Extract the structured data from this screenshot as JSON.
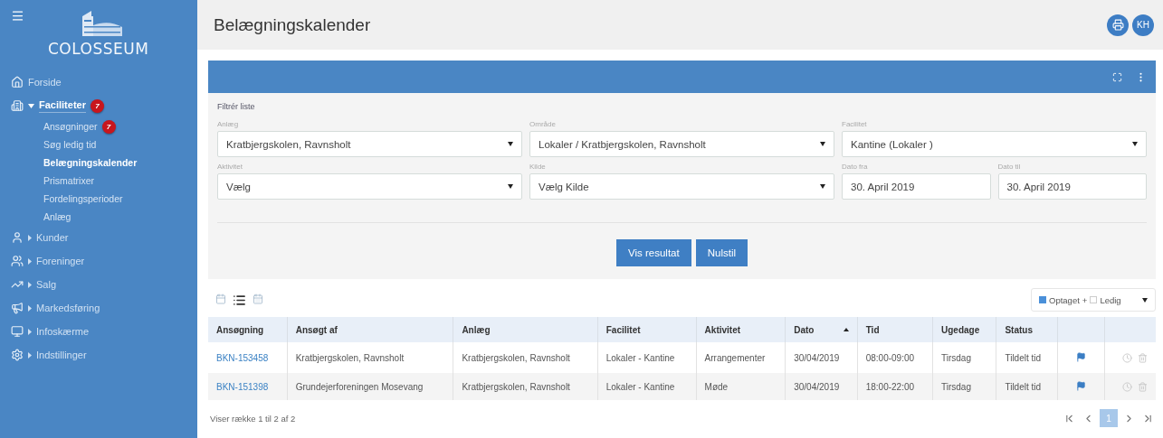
{
  "sidebar": {
    "logo_text": "COLOSSEUM",
    "items": [
      {
        "kind": "link",
        "label": "Forside"
      },
      {
        "kind": "group",
        "label": "Faciliteter",
        "expanded": true,
        "badge": "7",
        "children": [
          {
            "label": "Ansøgninger",
            "selected": false,
            "badge": "7"
          },
          {
            "label": "Søg ledig tid",
            "selected": false
          },
          {
            "label": "Belægningskalender",
            "selected": true
          },
          {
            "label": "Prismatrixer",
            "selected": false
          },
          {
            "label": "Fordelingsperioder",
            "selected": false
          },
          {
            "label": "Anlæg",
            "selected": false
          }
        ]
      },
      {
        "kind": "group",
        "label": "Kunder",
        "expanded": false
      },
      {
        "kind": "group",
        "label": "Foreninger",
        "expanded": false
      },
      {
        "kind": "group",
        "label": "Salg",
        "expanded": false
      },
      {
        "kind": "group",
        "label": "Markedsføring",
        "expanded": false
      },
      {
        "kind": "group",
        "label": "Infoskærme",
        "expanded": false
      },
      {
        "kind": "group",
        "label": "Indstillinger",
        "expanded": false
      }
    ]
  },
  "header": {
    "title": "Belægningskalender",
    "avatar": "KH"
  },
  "filter": {
    "title": "Filtrér liste",
    "fields": [
      {
        "kind": "select",
        "label": "Anlæg",
        "value": "Kratbjergskolen, Ravnsholt"
      },
      {
        "kind": "select",
        "label": "Område",
        "value": "Lokaler / Kratbjergskolen, Ravnsholt"
      },
      {
        "kind": "select",
        "label": "Facilitet",
        "value": "Kantine (Lokaler )"
      },
      {
        "kind": "select",
        "label": "Aktivitet",
        "value": "Vælg"
      },
      {
        "kind": "select",
        "label": "Kilde",
        "value": "Vælg Kilde"
      },
      {
        "kind": "date",
        "label": "Dato fra",
        "value": "30. April 2019"
      },
      {
        "kind": "date",
        "label": "Dato til",
        "value": "30. April 2019"
      }
    ],
    "buttons": [
      "Vis resultat",
      "Nulstil"
    ]
  },
  "views": [
    {
      "selected": false
    },
    {
      "selected": true
    },
    {
      "selected": false
    }
  ],
  "legend": {
    "filled_label": "Optaget",
    "joiner": "+",
    "empty_label": "Ledig"
  },
  "table": {
    "columns": [
      {
        "label": "Ansøgning",
        "sorted": false
      },
      {
        "label": "Ansøgt af",
        "sorted": false
      },
      {
        "label": "Anlæg",
        "sorted": false
      },
      {
        "label": "Facilitet",
        "sorted": false
      },
      {
        "label": "Aktivitet",
        "sorted": false
      },
      {
        "label": "Dato",
        "sorted": true
      },
      {
        "label": "Tid",
        "sorted": false
      },
      {
        "label": "Ugedage",
        "sorted": false
      },
      {
        "label": "Status",
        "sorted": false
      }
    ],
    "rows": [
      {
        "cells": [
          "BKN-153458",
          "Kratbjergskolen, Ravnsholt",
          "Kratbjergskolen, Ravnsholt",
          "Lokaler - Kantine",
          "Arrangementer",
          "30/04/2019",
          "08:00-09:00",
          "Tirsdag",
          "Tildelt tid"
        ],
        "flagged": true
      },
      {
        "cells": [
          "BKN-151398",
          "Grundejerforeningen Mosevang",
          "Kratbjergskolen, Ravnsholt",
          "Lokaler - Kantine",
          "Møde",
          "30/04/2019",
          "18:00-22:00",
          "Tirsdag",
          "Tildelt tid"
        ],
        "flagged": true
      }
    ]
  },
  "footer": {
    "summary": "Viser række 1 til 2 af 2",
    "pages": [
      {
        "label": "1",
        "selected": true
      }
    ]
  }
}
